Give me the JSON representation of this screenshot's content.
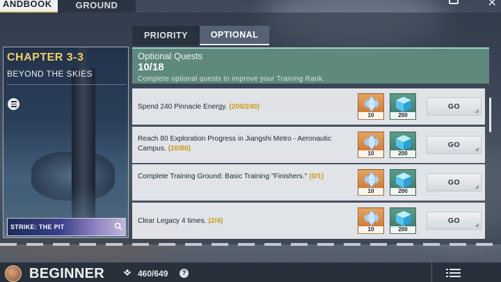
{
  "top_tabs": [
    {
      "label": "ANDBOOK",
      "active": true
    },
    {
      "label": "GROUND",
      "active": false
    }
  ],
  "inner_tabs": [
    {
      "label": "PRIORITY",
      "active": false
    },
    {
      "label": "OPTIONAL",
      "active": true
    }
  ],
  "chapter": {
    "number": "CHAPTER 3-3",
    "name": "BEYOND THE SKIES",
    "strike_label": "STRIKE: THE PIT"
  },
  "quests_header": {
    "title": "Optional Quests",
    "count": "10/18",
    "description": "Complete optional quests to improve your Training Rank."
  },
  "quests": [
    {
      "text": "Spend 240 Pinnacle Energy.",
      "progress": "(200/240)",
      "reward1_qty": "10",
      "reward2_qty": "200",
      "button": "GO"
    },
    {
      "text": "Reach 80 Exploration Progress in Jiangshi Metro - Aeronautic Campus.",
      "progress": "(10/80)",
      "reward1_qty": "10",
      "reward2_qty": "200",
      "button": "GO"
    },
    {
      "text": "Complete Training Ground: Basic Training \"Finishers.\"",
      "progress": "(0/1)",
      "reward1_qty": "10",
      "reward2_qty": "200",
      "button": "GO"
    },
    {
      "text": "Clear Legacy 4 times.",
      "progress": "(2/4)",
      "reward1_qty": "10",
      "reward2_qty": "200",
      "button": "GO"
    }
  ],
  "bottom_bar": {
    "rank": "BEGINNER",
    "xp": "460/649",
    "help": "?"
  },
  "icons": {
    "menu": "menu-icon",
    "search": "search-icon",
    "crystal": "crystal-icon",
    "cube": "cube-icon",
    "xp": "xp-wings-icon",
    "list": "list-icon",
    "close": "close-icon"
  },
  "colors": {
    "accent_gold": "#f2cf6a",
    "progress_gold": "#c99b13",
    "header_green": "#6ea08c",
    "reward_orange": "#c56f2c",
    "reward_teal": "#3d7467"
  }
}
